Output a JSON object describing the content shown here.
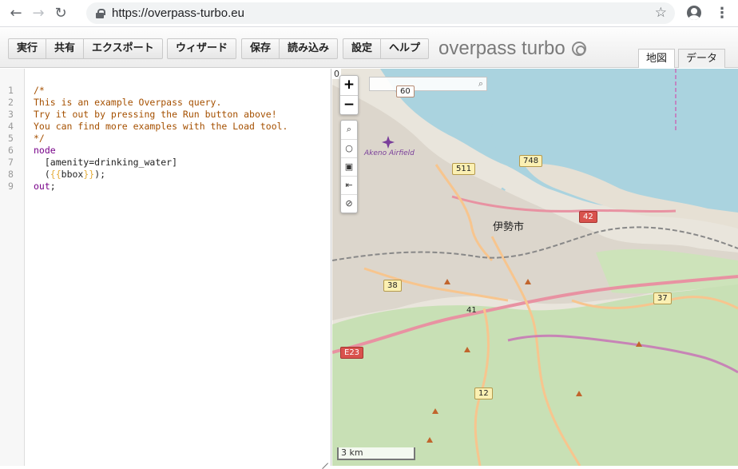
{
  "browser": {
    "url": "https://overpass-turbo.eu",
    "back_icon": "←",
    "forward_icon": "→",
    "reload_icon": "↻",
    "star_icon": "☆",
    "menu_icon": "⋮"
  },
  "toolbar": {
    "group1": [
      "実行",
      "共有",
      "エクスポート"
    ],
    "group2": [
      "ウィザード"
    ],
    "group3": [
      "保存",
      "読み込み"
    ],
    "group4": [
      "設定",
      "ヘルプ"
    ],
    "brand": "overpass turbo",
    "tabs": [
      "地図",
      "データ"
    ],
    "active_tab": "地図"
  },
  "editor": {
    "lines": [
      {
        "n": "1",
        "text": "/*",
        "kind": "comment"
      },
      {
        "n": "2",
        "text": "This is an example Overpass query.",
        "kind": "comment"
      },
      {
        "n": "3",
        "text": "Try it out by pressing the Run button above!",
        "kind": "comment"
      },
      {
        "n": "4",
        "text": "You can find more examples with the Load tool.",
        "kind": "comment"
      },
      {
        "n": "5",
        "text": "*/",
        "kind": "comment"
      },
      {
        "n": "6",
        "text": "node",
        "kind": "keyword"
      },
      {
        "n": "7",
        "text": "  [amenity=drinking_water]",
        "kind": "plain"
      },
      {
        "n": "8",
        "text": "  ({{bbox}});",
        "kind": "bbox"
      },
      {
        "n": "9",
        "text": "out;",
        "kind": "out"
      }
    ]
  },
  "map": {
    "zoom_level": "0",
    "zoom_in": "+",
    "zoom_out": "−",
    "controls": [
      "⌕",
      "○",
      "▣",
      "⇤",
      "⊘"
    ],
    "search_icon": "⌕",
    "city_label": "伊勢市",
    "airfield_label": "Akeno Airfield",
    "scale_label": "3 km",
    "road_shields": [
      {
        "label": "60",
        "style": "plain"
      },
      {
        "label": "511",
        "style": "yellow"
      },
      {
        "label": "748",
        "style": "yellow"
      },
      {
        "label": "42",
        "style": "red"
      },
      {
        "label": "38",
        "style": "yellow"
      },
      {
        "label": "37",
        "style": "yellow"
      },
      {
        "label": "E23",
        "style": "red"
      },
      {
        "label": "12",
        "style": "yellow"
      },
      {
        "label": "41",
        "style": "plain"
      }
    ],
    "colors": {
      "water": "#aad3df",
      "land": "#e9e5dc",
      "forest": "#c8e0b5",
      "urban": "#dcd6cc",
      "major_road": "#e892a2",
      "primary_road": "#f7c58e",
      "boundary": "#c76db7"
    }
  }
}
